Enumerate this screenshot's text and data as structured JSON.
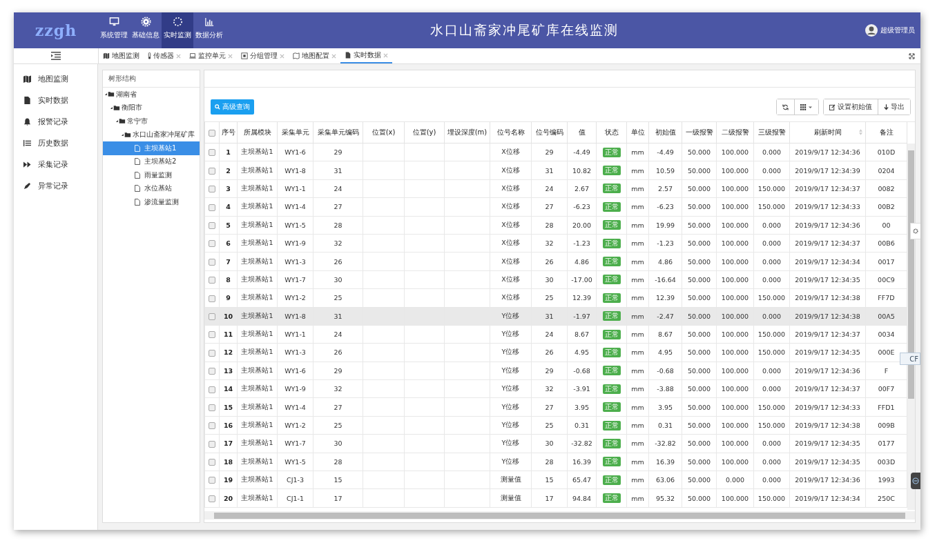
{
  "header": {
    "logo": "zzgh",
    "nav": [
      {
        "label": "系统管理",
        "selected": false
      },
      {
        "label": "基础信息",
        "selected": false
      },
      {
        "label": "实时监测",
        "selected": true
      },
      {
        "label": "数据分析",
        "selected": false
      }
    ],
    "title": "水口山斋家冲尾矿库在线监测",
    "user": "超级管理员"
  },
  "tabs": [
    {
      "label": "地图监测",
      "closable": false,
      "selected": false
    },
    {
      "label": "传感器",
      "closable": true,
      "selected": false
    },
    {
      "label": "监控单元",
      "closable": true,
      "selected": false
    },
    {
      "label": "分组管理",
      "closable": true,
      "selected": false
    },
    {
      "label": "地图配置",
      "closable": true,
      "selected": false
    },
    {
      "label": "实时数据",
      "closable": true,
      "selected": true
    }
  ],
  "sidebar": {
    "items": [
      {
        "label": "地图监测"
      },
      {
        "label": "实时数据"
      },
      {
        "label": "报警记录"
      },
      {
        "label": "历史数据"
      },
      {
        "label": "采集记录"
      },
      {
        "label": "异常记录"
      }
    ]
  },
  "tree": {
    "title": "树形结构",
    "nodes": [
      {
        "label": "湖南省",
        "kind": "folder",
        "selected": false,
        "children": [
          {
            "label": "衡阳市",
            "kind": "folder",
            "selected": false,
            "children": [
              {
                "label": "常宁市",
                "kind": "folder",
                "selected": false,
                "children": [
                  {
                    "label": "水口山斋家冲尾矿库",
                    "kind": "folder",
                    "selected": false,
                    "children": [
                      {
                        "label": "主坝基站1",
                        "kind": "file",
                        "selected": true
                      },
                      {
                        "label": "主坝基站2",
                        "kind": "file",
                        "selected": false
                      },
                      {
                        "label": "雨量监测",
                        "kind": "file",
                        "selected": false
                      },
                      {
                        "label": "水位基站",
                        "kind": "file",
                        "selected": false
                      },
                      {
                        "label": "渗流量监测",
                        "kind": "file",
                        "selected": false
                      }
                    ]
                  }
                ]
              }
            ]
          }
        ]
      }
    ]
  },
  "toolbar": {
    "search_button": "高级查询",
    "set_initial_button": "设置初始值",
    "export_button": "导出"
  },
  "table": {
    "header_checked": false,
    "columns": [
      {
        "label": "序号",
        "kind": "index"
      },
      {
        "label": "所属模块",
        "kind": "text"
      },
      {
        "label": "采集单元",
        "kind": "text"
      },
      {
        "label": "采集单元编码",
        "kind": "text"
      },
      {
        "label": "位置(x)",
        "kind": "text"
      },
      {
        "label": "位置(y)",
        "kind": "text"
      },
      {
        "label": "埋设深度(m)",
        "kind": "text"
      },
      {
        "label": "位号名称",
        "kind": "text"
      },
      {
        "label": "位号编码",
        "kind": "text"
      },
      {
        "label": "值",
        "kind": "text"
      },
      {
        "label": "状态",
        "kind": "status"
      },
      {
        "label": "单位",
        "kind": "text"
      },
      {
        "label": "初始值",
        "kind": "text"
      },
      {
        "label": "一级报警",
        "kind": "text"
      },
      {
        "label": "二级报警",
        "kind": "text"
      },
      {
        "label": "三级报警",
        "kind": "text"
      },
      {
        "label": "刷新时间",
        "kind": "sortable"
      },
      {
        "label": "备注",
        "kind": "text"
      }
    ],
    "rows": [
      {
        "checked": false,
        "hovered": false,
        "cells": [
          "1",
          "主坝基站1",
          "WY1-6",
          "29",
          "",
          "",
          "",
          "X位移",
          "29",
          "-4.49",
          "正常",
          "mm",
          "-4.49",
          "50.000",
          "100.000",
          "0.000",
          "2019/9/17 12:34:36",
          "010D"
        ]
      },
      {
        "checked": false,
        "hovered": false,
        "cells": [
          "2",
          "主坝基站1",
          "WY1-8",
          "31",
          "",
          "",
          "",
          "X位移",
          "31",
          "10.82",
          "正常",
          "mm",
          "10.59",
          "50.000",
          "100.000",
          "0.000",
          "2019/9/17 12:34:39",
          "0204"
        ]
      },
      {
        "checked": false,
        "hovered": false,
        "cells": [
          "3",
          "主坝基站1",
          "WY1-1",
          "24",
          "",
          "",
          "",
          "X位移",
          "24",
          "2.67",
          "正常",
          "mm",
          "2.57",
          "50.000",
          "100.000",
          "150.000",
          "2019/9/17 12:34:37",
          "0082"
        ]
      },
      {
        "checked": false,
        "hovered": false,
        "cells": [
          "4",
          "主坝基站1",
          "WY1-4",
          "27",
          "",
          "",
          "",
          "X位移",
          "27",
          "-6.23",
          "正常",
          "mm",
          "-6.23",
          "50.000",
          "100.000",
          "150.000",
          "2019/9/17 12:34:33",
          "00B2"
        ]
      },
      {
        "checked": false,
        "hovered": false,
        "cells": [
          "5",
          "主坝基站1",
          "WY1-5",
          "28",
          "",
          "",
          "",
          "X位移",
          "28",
          "20.00",
          "正常",
          "mm",
          "19.99",
          "50.000",
          "100.000",
          "0.000",
          "2019/9/17 12:34:36",
          "00"
        ]
      },
      {
        "checked": false,
        "hovered": false,
        "cells": [
          "6",
          "主坝基站1",
          "WY1-9",
          "32",
          "",
          "",
          "",
          "X位移",
          "32",
          "-1.23",
          "正常",
          "mm",
          "-1.23",
          "50.000",
          "100.000",
          "0.000",
          "2019/9/17 12:34:37",
          "00B6"
        ]
      },
      {
        "checked": false,
        "hovered": false,
        "cells": [
          "7",
          "主坝基站1",
          "WY1-3",
          "26",
          "",
          "",
          "",
          "X位移",
          "26",
          "4.86",
          "正常",
          "mm",
          "4.86",
          "50.000",
          "100.000",
          "0.000",
          "2019/9/17 12:34:34",
          "0017"
        ]
      },
      {
        "checked": false,
        "hovered": false,
        "cells": [
          "8",
          "主坝基站1",
          "WY1-7",
          "30",
          "",
          "",
          "",
          "X位移",
          "30",
          "-17.00",
          "正常",
          "mm",
          "-16.64",
          "50.000",
          "100.000",
          "0.000",
          "2019/9/17 12:34:35",
          "00C9"
        ]
      },
      {
        "checked": false,
        "hovered": false,
        "cells": [
          "9",
          "主坝基站1",
          "WY1-2",
          "25",
          "",
          "",
          "",
          "X位移",
          "25",
          "12.39",
          "正常",
          "mm",
          "12.39",
          "50.000",
          "100.000",
          "150.000",
          "2019/9/17 12:34:38",
          "FF7D"
        ]
      },
      {
        "checked": false,
        "hovered": true,
        "cells": [
          "10",
          "主坝基站1",
          "WY1-8",
          "31",
          "",
          "",
          "",
          "Y位移",
          "31",
          "-1.97",
          "正常",
          "mm",
          "-2.47",
          "50.000",
          "100.000",
          "0.000",
          "2019/9/17 12:34:38",
          "00A5"
        ]
      },
      {
        "checked": false,
        "hovered": false,
        "cells": [
          "11",
          "主坝基站1",
          "WY1-1",
          "24",
          "",
          "",
          "",
          "Y位移",
          "24",
          "8.67",
          "正常",
          "mm",
          "8.67",
          "50.000",
          "100.000",
          "150.000",
          "2019/9/17 12:34:37",
          "0034"
        ]
      },
      {
        "checked": false,
        "hovered": false,
        "cells": [
          "12",
          "主坝基站1",
          "WY1-3",
          "26",
          "",
          "",
          "",
          "Y位移",
          "26",
          "4.95",
          "正常",
          "mm",
          "4.95",
          "50.000",
          "100.000",
          "150.000",
          "2019/9/17 12:34:35",
          "000E"
        ]
      },
      {
        "checked": false,
        "hovered": false,
        "cells": [
          "13",
          "主坝基站1",
          "WY1-6",
          "29",
          "",
          "",
          "",
          "Y位移",
          "29",
          "-0.68",
          "正常",
          "mm",
          "-0.68",
          "50.000",
          "100.000",
          "0.000",
          "2019/9/17 12:34:36",
          "F"
        ]
      },
      {
        "checked": false,
        "hovered": false,
        "cells": [
          "14",
          "主坝基站1",
          "WY1-9",
          "32",
          "",
          "",
          "",
          "Y位移",
          "32",
          "-3.91",
          "正常",
          "mm",
          "-3.88",
          "50.000",
          "100.000",
          "0.000",
          "2019/9/17 12:34:37",
          "00F7"
        ]
      },
      {
        "checked": false,
        "hovered": false,
        "cells": [
          "15",
          "主坝基站1",
          "WY1-4",
          "27",
          "",
          "",
          "",
          "Y位移",
          "27",
          "3.95",
          "正常",
          "mm",
          "3.95",
          "50.000",
          "100.000",
          "150.000",
          "2019/9/17 12:34:33",
          "FFD1"
        ]
      },
      {
        "checked": false,
        "hovered": false,
        "cells": [
          "16",
          "主坝基站1",
          "WY1-2",
          "25",
          "",
          "",
          "",
          "Y位移",
          "25",
          "0.31",
          "正常",
          "mm",
          "0.31",
          "50.000",
          "100.000",
          "150.000",
          "2019/9/17 12:34:38",
          "009B"
        ]
      },
      {
        "checked": false,
        "hovered": false,
        "cells": [
          "17",
          "主坝基站1",
          "WY1-7",
          "30",
          "",
          "",
          "",
          "Y位移",
          "30",
          "-32.82",
          "正常",
          "mm",
          "-32.82",
          "50.000",
          "100.000",
          "0.000",
          "2019/9/17 12:34:35",
          "0177"
        ]
      },
      {
        "checked": false,
        "hovered": false,
        "cells": [
          "18",
          "主坝基站1",
          "WY1-5",
          "28",
          "",
          "",
          "",
          "Y位移",
          "28",
          "16.39",
          "正常",
          "mm",
          "16.39",
          "50.000",
          "100.000",
          "0.000",
          "2019/9/17 12:34:35",
          "003D"
        ]
      },
      {
        "checked": false,
        "hovered": false,
        "cells": [
          "19",
          "主坝基站1",
          "CJ1-3",
          "15",
          "",
          "",
          "",
          "测量值",
          "15",
          "65.47",
          "正常",
          "mm",
          "63.06",
          "50.000",
          "0.000",
          "0.000",
          "2019/9/17 12:34:36",
          "1993"
        ]
      },
      {
        "checked": false,
        "hovered": false,
        "cells": [
          "20",
          "主坝基站1",
          "CJ1-1",
          "17",
          "",
          "",
          "",
          "测量值",
          "17",
          "94.84",
          "正常",
          "mm",
          "95.32",
          "50.000",
          "100.000",
          "150.000",
          "2019/9/17 12:34:34",
          "250C"
        ]
      }
    ]
  },
  "floating_tab": "CF"
}
